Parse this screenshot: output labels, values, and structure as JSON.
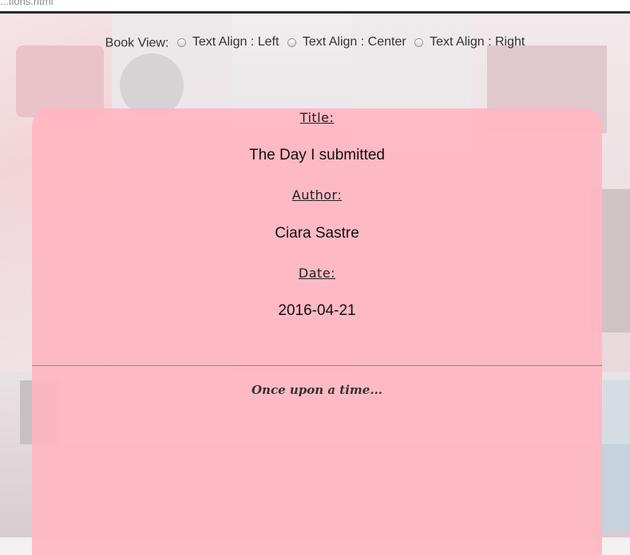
{
  "browser": {
    "file_name": "...tions.html"
  },
  "view_options": {
    "label": "Book View:",
    "options": [
      {
        "label": "Text Align : Left",
        "checked": false
      },
      {
        "label": "Text Align : Center",
        "checked": false
      },
      {
        "label": "Text Align : Right",
        "checked": false
      }
    ]
  },
  "book": {
    "title_label": "Title:",
    "title": "The Day I submitted",
    "author_label": "Author:",
    "author": "Ciara Sastre",
    "date_label": "Date:",
    "date": "2016-04-21",
    "story": "Once upon a time..."
  },
  "colors": {
    "card": "#ffb6c1",
    "divider": "#8a8a8a"
  }
}
